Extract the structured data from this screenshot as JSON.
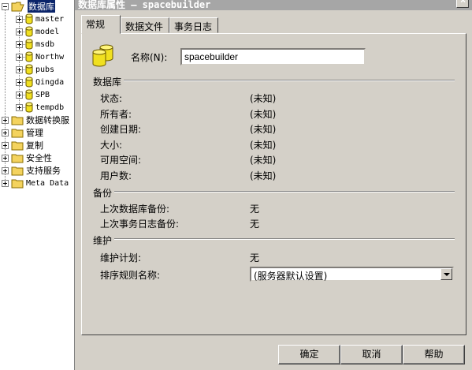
{
  "tree": {
    "databases": "数据库",
    "db_items": [
      "master",
      "model",
      "msdb",
      "Northw",
      "pubs",
      "Qingda",
      "SPB",
      "tempdb"
    ],
    "top_items": [
      "数据转换服",
      "管理",
      "复制",
      "安全性",
      "支持服务",
      "Meta Data"
    ]
  },
  "dialog": {
    "title": "数据库属性 — spacebuilder",
    "close": "×",
    "tabs": [
      "常规",
      "数据文件",
      "事务日志"
    ],
    "name_label": "名称(N):",
    "name_value": "spacebuilder",
    "section_db": "数据库",
    "db_fields": [
      {
        "label": "状态:",
        "value": "(未知)"
      },
      {
        "label": "所有者:",
        "value": "(未知)"
      },
      {
        "label": "创建日期:",
        "value": "(未知)"
      },
      {
        "label": "大小:",
        "value": "(未知)"
      },
      {
        "label": "可用空间:",
        "value": "(未知)"
      },
      {
        "label": "用户数:",
        "value": "(未知)"
      }
    ],
    "section_backup": "备份",
    "backup_fields": [
      {
        "label": "上次数据库备份:",
        "value": "无"
      },
      {
        "label": "上次事务日志备份:",
        "value": "无"
      }
    ],
    "section_maint": "维护",
    "maint_plan_label": "维护计划:",
    "maint_plan_value": "无",
    "collation_label": "排序规则名称:",
    "collation_value": "(服务器默认设置)",
    "buttons": {
      "ok": "确定",
      "cancel": "取消",
      "help": "帮助"
    }
  }
}
